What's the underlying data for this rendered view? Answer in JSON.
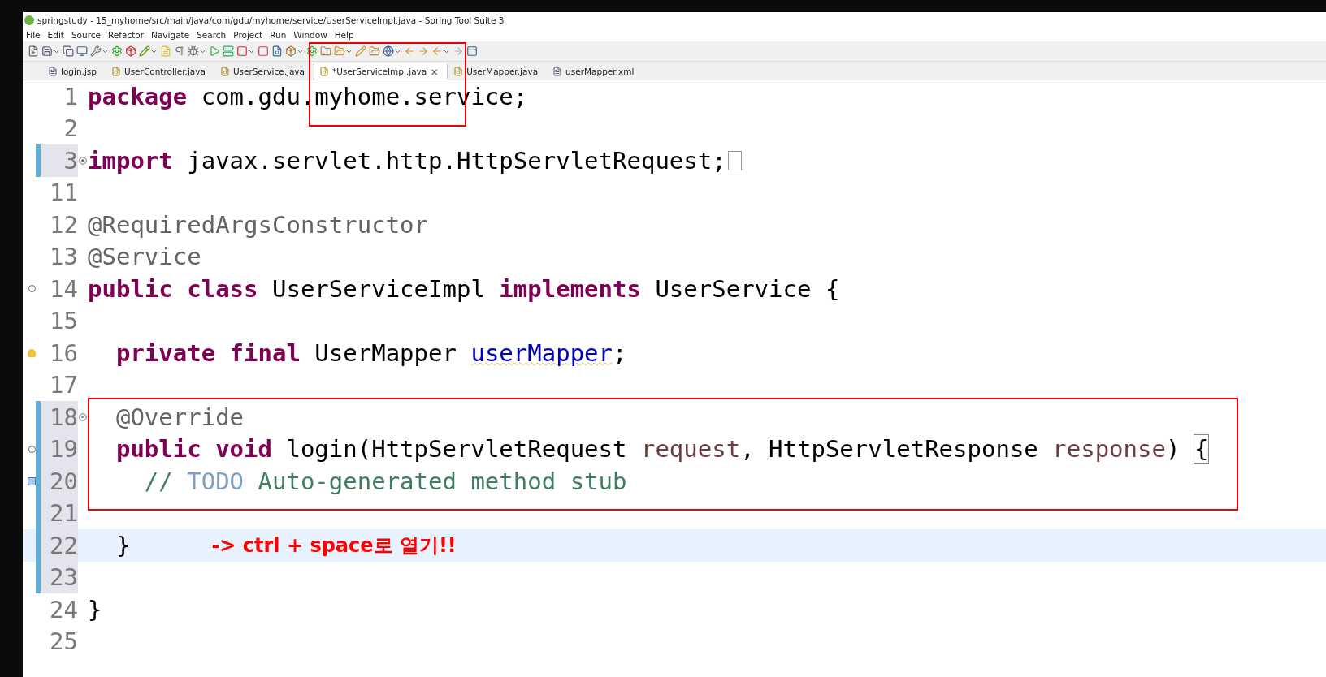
{
  "window": {
    "title": "springstudy - 15_myhome/src/main/java/com/gdu/myhome/service/UserServiceImpl.java - Spring Tool Suite 3"
  },
  "menu": [
    "File",
    "Edit",
    "Source",
    "Refactor",
    "Navigate",
    "Search",
    "Project",
    "Run",
    "Window",
    "Help"
  ],
  "tabs": [
    {
      "label": "login.jsp",
      "kind": "jsp",
      "selected": false
    },
    {
      "label": "UserController.java",
      "kind": "java",
      "selected": false
    },
    {
      "label": "UserService.java",
      "kind": "java",
      "selected": false
    },
    {
      "label": "*UserServiceImpl.java",
      "kind": "java",
      "selected": true
    },
    {
      "label": "UserMapper.java",
      "kind": "java",
      "selected": false
    },
    {
      "label": "userMapper.xml",
      "kind": "xml",
      "selected": false
    }
  ],
  "close_glyph": "×",
  "editor": {
    "lines": [
      {
        "number": "1",
        "changed": false,
        "current": false,
        "boxed": false,
        "tokens": [
          {
            "kind": "keyword",
            "text": "package"
          },
          {
            "kind": "plain",
            "text": " com.gdu.myhome.service;"
          }
        ]
      },
      {
        "number": "2",
        "changed": false,
        "current": false,
        "boxed": false
      },
      {
        "number": "3",
        "fold": {
          "kind": "expand"
        },
        "folded": true,
        "changed": true,
        "current": false,
        "boxed": false,
        "tokens": [
          {
            "kind": "keyword",
            "text": "import"
          },
          {
            "kind": "plain",
            "text": " javax.servlet.http.HttpServletRequest;"
          }
        ]
      },
      {
        "number": "11",
        "changed": false,
        "current": false,
        "boxed": false
      },
      {
        "number": "12",
        "changed": false,
        "current": false,
        "boxed": false,
        "tokens": [
          {
            "kind": "annotation",
            "text": "@RequiredArgsConstructor"
          }
        ]
      },
      {
        "number": "13",
        "changed": false,
        "current": false,
        "boxed": false,
        "tokens": [
          {
            "kind": "annotation",
            "text": "@Service"
          }
        ]
      },
      {
        "number": "14",
        "marker": {
          "kind": "override"
        },
        "changed": false,
        "current": false,
        "boxed": false,
        "tokens": [
          {
            "kind": "keyword",
            "text": "public class"
          },
          {
            "kind": "plain",
            "text": " UserServiceImpl "
          },
          {
            "kind": "keyword",
            "text": "implements"
          },
          {
            "kind": "plain",
            "text": " UserService {"
          }
        ]
      },
      {
        "number": "15",
        "changed": false,
        "current": false,
        "boxed": false
      },
      {
        "number": "16",
        "marker": {
          "kind": "warning"
        },
        "changed": false,
        "current": false,
        "boxed": false,
        "tokens": [
          {
            "kind": "keyword",
            "text": "  private final"
          },
          {
            "kind": "plain",
            "text": " UserMapper "
          },
          {
            "kind": "field",
            "text": "userMapper"
          },
          {
            "kind": "plain",
            "text": ";"
          }
        ]
      },
      {
        "number": "17",
        "changed": false,
        "current": false,
        "boxed": false
      },
      {
        "number": "18",
        "fold": {
          "kind": "collapse"
        },
        "changed": true,
        "current": false,
        "boxed": true,
        "tokens": [
          {
            "kind": "annotation",
            "text": "  @Override"
          }
        ]
      },
      {
        "number": "19",
        "marker": {
          "kind": "override"
        },
        "changed": true,
        "current": false,
        "boxed": true,
        "tokens": [
          {
            "kind": "keyword",
            "text": "  public void"
          },
          {
            "kind": "plain",
            "text": " login(HttpServletRequest "
          },
          {
            "kind": "param",
            "text": "request"
          },
          {
            "kind": "plain",
            "text": ", HttpServletResponse "
          },
          {
            "kind": "param",
            "text": "response"
          },
          {
            "kind": "plain",
            "text": ") "
          },
          {
            "kind": "bracket",
            "text": "{"
          }
        ]
      },
      {
        "number": "20",
        "marker": {
          "kind": "task"
        },
        "changed": true,
        "current": false,
        "boxed": true,
        "tokens": [
          {
            "kind": "comment",
            "text": "    // "
          },
          {
            "kind": "todo",
            "text": "TODO"
          },
          {
            "kind": "comment",
            "text": " Auto-generated method stub"
          }
        ]
      },
      {
        "number": "21",
        "changed": true,
        "current": false,
        "boxed": false
      },
      {
        "number": "22",
        "changed": true,
        "current": true,
        "boxed": false,
        "tokens": [
          {
            "kind": "plain",
            "text": "  }"
          }
        ],
        "note": "-> ctrl + space로 열기!!"
      },
      {
        "number": "23",
        "changed": true,
        "current": false,
        "boxed": false
      },
      {
        "number": "24",
        "changed": false,
        "current": false,
        "boxed": false,
        "tokens": [
          {
            "kind": "plain",
            "text": "}"
          }
        ]
      },
      {
        "number": "25",
        "changed": false,
        "current": false,
        "boxed": false
      }
    ]
  }
}
